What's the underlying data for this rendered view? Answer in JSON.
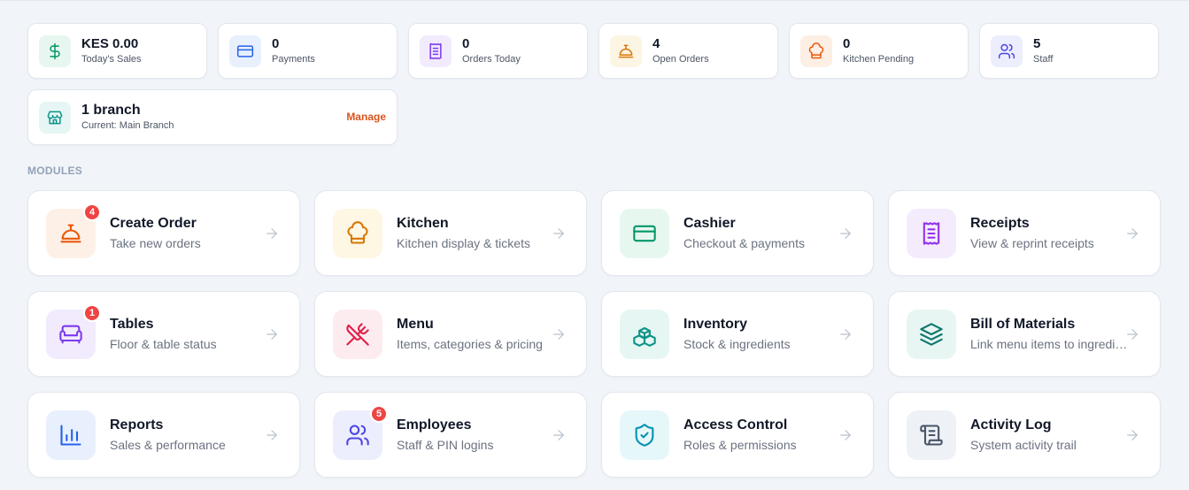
{
  "stats": [
    {
      "value": "KES 0.00",
      "label": "Today's Sales",
      "icon": "dollar-icon",
      "color": "#059669",
      "bg": "#e7f7ef"
    },
    {
      "value": "0",
      "label": "Payments",
      "icon": "card-icon",
      "color": "#2563eb",
      "bg": "#e8effd"
    },
    {
      "value": "0",
      "label": "Orders Today",
      "icon": "receipt-icon",
      "color": "#7c3aed",
      "bg": "#f1ebfd"
    },
    {
      "value": "4",
      "label": "Open Orders",
      "icon": "bell-icon",
      "color": "#d97706",
      "bg": "#fdf5e4"
    },
    {
      "value": "0",
      "label": "Kitchen Pending",
      "icon": "chef-hat-icon",
      "color": "#ea580c",
      "bg": "#fdefe4"
    },
    {
      "value": "5",
      "label": "Staff",
      "icon": "users-icon",
      "color": "#4f46e5",
      "bg": "#ecedfd"
    }
  ],
  "branch": {
    "value": "1 branch",
    "label": "Current: Main Branch",
    "action": "Manage",
    "icon": "store-icon",
    "color": "#0d9488",
    "bg": "#e6f6f4"
  },
  "section_title": "MODULES",
  "modules": [
    {
      "title": "Create Order",
      "subtitle": "Take new orders",
      "badge": "4",
      "icon": "bell-icon",
      "color": "#ea580c",
      "bg": "#fdf1e7"
    },
    {
      "title": "Kitchen",
      "subtitle": "Kitchen display & tickets",
      "badge": "",
      "icon": "chef-hat-icon",
      "color": "#d97706",
      "bg": "#fdf7e3"
    },
    {
      "title": "Cashier",
      "subtitle": "Checkout & payments",
      "badge": "",
      "icon": "card-icon",
      "color": "#059669",
      "bg": "#e6f7ef"
    },
    {
      "title": "Receipts",
      "subtitle": "View & reprint receipts",
      "badge": "",
      "icon": "receipt-icon",
      "color": "#9333ea",
      "bg": "#f4ebfd"
    },
    {
      "title": "Tables",
      "subtitle": "Floor & table status",
      "badge": "1",
      "icon": "sofa-icon",
      "color": "#7c3aed",
      "bg": "#f1ebfd"
    },
    {
      "title": "Menu",
      "subtitle": "Items, categories & pricing",
      "badge": "",
      "icon": "utensils-icon",
      "color": "#e11d48",
      "bg": "#fdecef"
    },
    {
      "title": "Inventory",
      "subtitle": "Stock & ingredients",
      "badge": "",
      "icon": "boxes-icon",
      "color": "#0d9488",
      "bg": "#e5f6f3"
    },
    {
      "title": "Bill of Materials",
      "subtitle": "Link menu items to ingredients",
      "badge": "",
      "icon": "layers-icon",
      "color": "#0f766e",
      "bg": "#e7f6f2"
    },
    {
      "title": "Reports",
      "subtitle": "Sales & performance",
      "badge": "",
      "icon": "bar-chart-icon",
      "color": "#2563eb",
      "bg": "#e9f0fd"
    },
    {
      "title": "Employees",
      "subtitle": "Staff & PIN logins",
      "badge": "5",
      "icon": "users-icon",
      "color": "#4f46e5",
      "bg": "#eceefd"
    },
    {
      "title": "Access Control",
      "subtitle": "Roles & permissions",
      "badge": "",
      "icon": "shield-check-icon",
      "color": "#0891b2",
      "bg": "#e6f7fa"
    },
    {
      "title": "Activity Log",
      "subtitle": "System activity trail",
      "badge": "",
      "icon": "scroll-icon",
      "color": "#475569",
      "bg": "#eef1f5"
    }
  ]
}
